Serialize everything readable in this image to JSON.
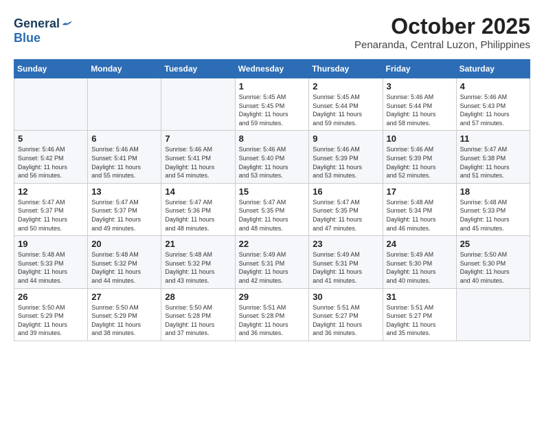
{
  "logo": {
    "general": "General",
    "blue": "Blue"
  },
  "header": {
    "month_year": "October 2025",
    "location": "Penaranda, Central Luzon, Philippines"
  },
  "weekdays": [
    "Sunday",
    "Monday",
    "Tuesday",
    "Wednesday",
    "Thursday",
    "Friday",
    "Saturday"
  ],
  "weeks": [
    [
      {
        "day": "",
        "info": ""
      },
      {
        "day": "",
        "info": ""
      },
      {
        "day": "",
        "info": ""
      },
      {
        "day": "1",
        "info": "Sunrise: 5:45 AM\nSunset: 5:45 PM\nDaylight: 11 hours\nand 59 minutes."
      },
      {
        "day": "2",
        "info": "Sunrise: 5:45 AM\nSunset: 5:44 PM\nDaylight: 11 hours\nand 59 minutes."
      },
      {
        "day": "3",
        "info": "Sunrise: 5:46 AM\nSunset: 5:44 PM\nDaylight: 11 hours\nand 58 minutes."
      },
      {
        "day": "4",
        "info": "Sunrise: 5:46 AM\nSunset: 5:43 PM\nDaylight: 11 hours\nand 57 minutes."
      }
    ],
    [
      {
        "day": "5",
        "info": "Sunrise: 5:46 AM\nSunset: 5:42 PM\nDaylight: 11 hours\nand 56 minutes."
      },
      {
        "day": "6",
        "info": "Sunrise: 5:46 AM\nSunset: 5:41 PM\nDaylight: 11 hours\nand 55 minutes."
      },
      {
        "day": "7",
        "info": "Sunrise: 5:46 AM\nSunset: 5:41 PM\nDaylight: 11 hours\nand 54 minutes."
      },
      {
        "day": "8",
        "info": "Sunrise: 5:46 AM\nSunset: 5:40 PM\nDaylight: 11 hours\nand 53 minutes."
      },
      {
        "day": "9",
        "info": "Sunrise: 5:46 AM\nSunset: 5:39 PM\nDaylight: 11 hours\nand 53 minutes."
      },
      {
        "day": "10",
        "info": "Sunrise: 5:46 AM\nSunset: 5:39 PM\nDaylight: 11 hours\nand 52 minutes."
      },
      {
        "day": "11",
        "info": "Sunrise: 5:47 AM\nSunset: 5:38 PM\nDaylight: 11 hours\nand 51 minutes."
      }
    ],
    [
      {
        "day": "12",
        "info": "Sunrise: 5:47 AM\nSunset: 5:37 PM\nDaylight: 11 hours\nand 50 minutes."
      },
      {
        "day": "13",
        "info": "Sunrise: 5:47 AM\nSunset: 5:37 PM\nDaylight: 11 hours\nand 49 minutes."
      },
      {
        "day": "14",
        "info": "Sunrise: 5:47 AM\nSunset: 5:36 PM\nDaylight: 11 hours\nand 48 minutes."
      },
      {
        "day": "15",
        "info": "Sunrise: 5:47 AM\nSunset: 5:35 PM\nDaylight: 11 hours\nand 48 minutes."
      },
      {
        "day": "16",
        "info": "Sunrise: 5:47 AM\nSunset: 5:35 PM\nDaylight: 11 hours\nand 47 minutes."
      },
      {
        "day": "17",
        "info": "Sunrise: 5:48 AM\nSunset: 5:34 PM\nDaylight: 11 hours\nand 46 minutes."
      },
      {
        "day": "18",
        "info": "Sunrise: 5:48 AM\nSunset: 5:33 PM\nDaylight: 11 hours\nand 45 minutes."
      }
    ],
    [
      {
        "day": "19",
        "info": "Sunrise: 5:48 AM\nSunset: 5:33 PM\nDaylight: 11 hours\nand 44 minutes."
      },
      {
        "day": "20",
        "info": "Sunrise: 5:48 AM\nSunset: 5:32 PM\nDaylight: 11 hours\nand 44 minutes."
      },
      {
        "day": "21",
        "info": "Sunrise: 5:48 AM\nSunset: 5:32 PM\nDaylight: 11 hours\nand 43 minutes."
      },
      {
        "day": "22",
        "info": "Sunrise: 5:49 AM\nSunset: 5:31 PM\nDaylight: 11 hours\nand 42 minutes."
      },
      {
        "day": "23",
        "info": "Sunrise: 5:49 AM\nSunset: 5:31 PM\nDaylight: 11 hours\nand 41 minutes."
      },
      {
        "day": "24",
        "info": "Sunrise: 5:49 AM\nSunset: 5:30 PM\nDaylight: 11 hours\nand 40 minutes."
      },
      {
        "day": "25",
        "info": "Sunrise: 5:50 AM\nSunset: 5:30 PM\nDaylight: 11 hours\nand 40 minutes."
      }
    ],
    [
      {
        "day": "26",
        "info": "Sunrise: 5:50 AM\nSunset: 5:29 PM\nDaylight: 11 hours\nand 39 minutes."
      },
      {
        "day": "27",
        "info": "Sunrise: 5:50 AM\nSunset: 5:29 PM\nDaylight: 11 hours\nand 38 minutes."
      },
      {
        "day": "28",
        "info": "Sunrise: 5:50 AM\nSunset: 5:28 PM\nDaylight: 11 hours\nand 37 minutes."
      },
      {
        "day": "29",
        "info": "Sunrise: 5:51 AM\nSunset: 5:28 PM\nDaylight: 11 hours\nand 36 minutes."
      },
      {
        "day": "30",
        "info": "Sunrise: 5:51 AM\nSunset: 5:27 PM\nDaylight: 11 hours\nand 36 minutes."
      },
      {
        "day": "31",
        "info": "Sunrise: 5:51 AM\nSunset: 5:27 PM\nDaylight: 11 hours\nand 35 minutes."
      },
      {
        "day": "",
        "info": ""
      }
    ]
  ]
}
